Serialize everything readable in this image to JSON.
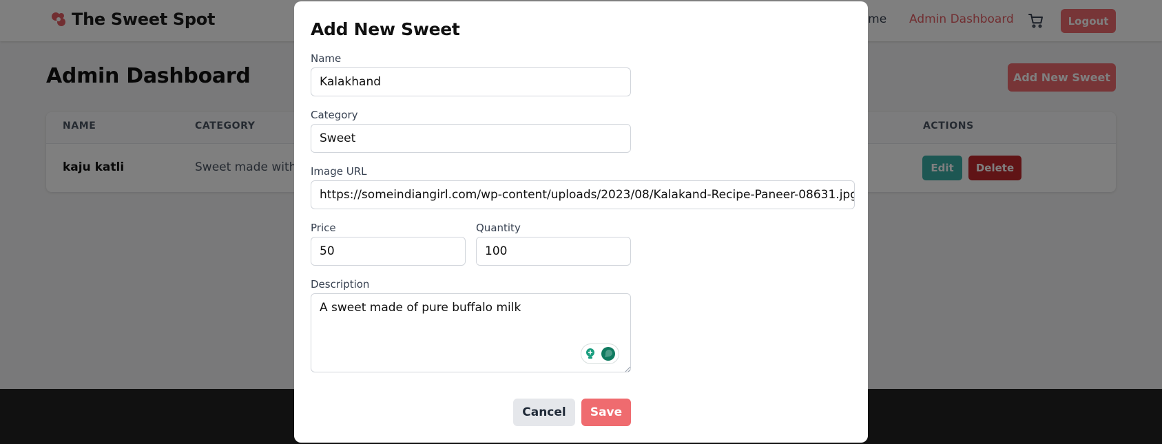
{
  "navbar": {
    "brand": "The Sweet Spot",
    "brand_icon": "candy-icon",
    "home_label": "Home",
    "admin_label": "Admin Dashboard",
    "cart_icon": "cart-icon",
    "logout_label": "Logout"
  },
  "dashboard": {
    "title": "Admin Dashboard",
    "add_button_label": "Add New Sweet",
    "columns": [
      "NAME",
      "CATEGORY",
      "ACTIONS"
    ],
    "rows": [
      {
        "name": "kaju katli",
        "category": "Sweet made with",
        "edit_label": "Edit",
        "delete_label": "Delete"
      }
    ]
  },
  "modal": {
    "title": "Add New Sweet",
    "fields": {
      "name": {
        "label": "Name",
        "value": "Kalakhand"
      },
      "category": {
        "label": "Category",
        "value": "Sweet"
      },
      "image_url": {
        "label": "Image URL",
        "value": "https://someindiangirl.com/wp-content/uploads/2023/08/Kalakand-Recipe-Paneer-08631.jpg"
      },
      "price": {
        "label": "Price",
        "value": "50"
      },
      "quantity": {
        "label": "Quantity",
        "value": "100"
      },
      "description": {
        "label": "Description",
        "value": "A sweet made of pure buffalo milk"
      }
    },
    "cancel_label": "Cancel",
    "save_label": "Save"
  },
  "colors": {
    "accent": "#ef6b6f",
    "edit": "#3aaea6",
    "delete": "#c0282c",
    "overlay": "rgba(0,0,0,0.5)"
  }
}
